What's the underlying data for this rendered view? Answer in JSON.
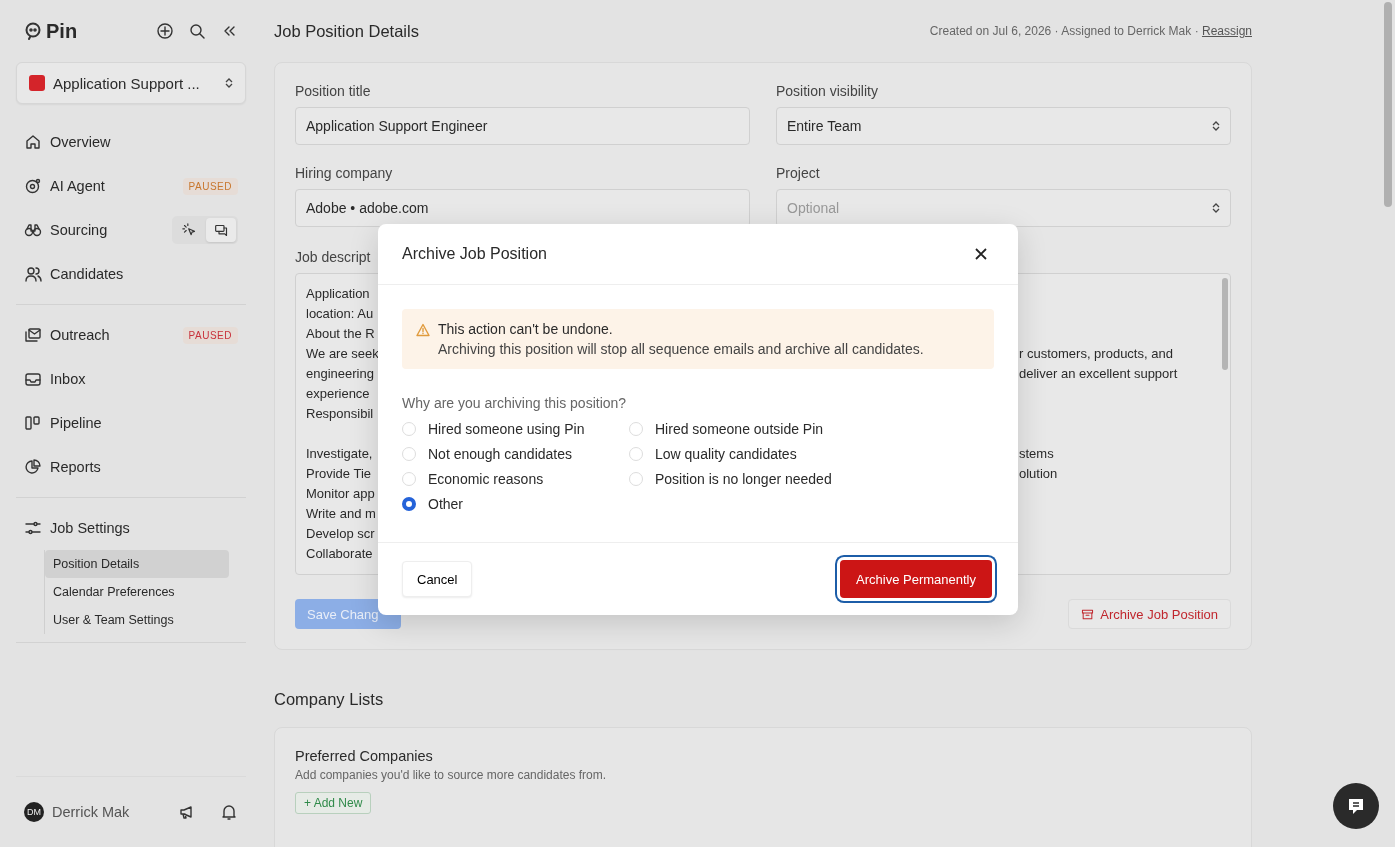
{
  "sidebar": {
    "brand": "Pin",
    "job_selector": {
      "label": "Application Support ..."
    },
    "groups": [
      [
        {
          "kind": "nav",
          "label": "Overview"
        },
        {
          "kind": "nav",
          "label": "AI Agent",
          "badge": {
            "text": "PAUSED",
            "color": "#c8772e"
          }
        },
        {
          "kind": "toggle",
          "label": "Sourcing",
          "toggle": [
            {
              "selected": false
            },
            {
              "selected": true
            }
          ]
        },
        {
          "kind": "nav",
          "label": "Candidates"
        }
      ],
      [
        {
          "kind": "nav",
          "label": "Outreach",
          "badge": {
            "text": "PAUSED",
            "color": "#c8323c"
          }
        },
        {
          "kind": "nav",
          "label": "Inbox"
        },
        {
          "kind": "nav",
          "label": "Pipeline"
        },
        {
          "kind": "nav",
          "label": "Reports"
        }
      ],
      [
        {
          "kind": "nav",
          "label": "Job Settings",
          "children": [
            {
              "label": "Position Details",
              "selected": true
            },
            {
              "label": "Calendar Preferences",
              "selected": false
            },
            {
              "label": "User & Team Settings",
              "selected": false
            }
          ]
        }
      ]
    ],
    "user": {
      "initials": "DM",
      "name": "Derrick Mak"
    }
  },
  "header": {
    "title": "Job Position Details",
    "meta": "Created on Jul 6, 2026 · Assigned to Derrick Mak · ",
    "link": "Reassign"
  },
  "form": {
    "position_title": {
      "label": "Position title",
      "value": "Application Support Engineer"
    },
    "position_visibility": {
      "label": "Position visibility",
      "value": "Entire Team"
    },
    "hiring_company": {
      "label": "Hiring company",
      "value": "Adobe • adobe.com"
    },
    "project": {
      "label": "Project",
      "placeholder": "Optional"
    },
    "job_description": {
      "label": "Job descript",
      "paragraphs": [
        [
          {
            "left": "Application"
          },
          {
            "left": "location: Au"
          },
          {
            "left": "About the R"
          },
          {
            "left": "We are seek",
            "right": "r customers, products, and"
          },
          {
            "left": "engineering",
            "right": "deliver an excellent support"
          },
          {
            "left": "experience"
          },
          {
            "left": "Responsibil"
          }
        ],
        [
          {
            "left": "Investigate,",
            "right": "stems"
          },
          {
            "left": "Provide Tie",
            "right": "olution"
          },
          {
            "left": "Monitor app"
          },
          {
            "left": "Write and m"
          },
          {
            "left": "Develop scr"
          },
          {
            "left": "Collaborate"
          }
        ]
      ]
    },
    "save_button": {
      "label": "Save Chang",
      "disabled": true
    },
    "archive_button": {
      "label": "Archive Job Position"
    }
  },
  "company_lists": {
    "title": "Company Lists",
    "card": {
      "title": "Preferred Companies",
      "subtitle": "Add companies you'd like to source more candidates from.",
      "add_button": "+ Add New"
    }
  },
  "modal": {
    "title": "Archive Job Position",
    "warning": {
      "title": "This action can't be undone.",
      "text": "Archiving this position will stop all sequence emails and archive all candidates."
    },
    "question": "Why are you archiving this position?",
    "options": [
      {
        "label": "Hired someone using Pin",
        "selected": false
      },
      {
        "label": "Hired someone outside Pin",
        "selected": false
      },
      {
        "label": "Not enough candidates",
        "selected": false
      },
      {
        "label": "Low quality candidates",
        "selected": false
      },
      {
        "label": "Economic reasons",
        "selected": false
      },
      {
        "label": "Position is no longer needed",
        "selected": false
      },
      {
        "label": "Other",
        "selected": true
      }
    ],
    "cancel": "Cancel",
    "confirm": "Archive Permanently"
  }
}
